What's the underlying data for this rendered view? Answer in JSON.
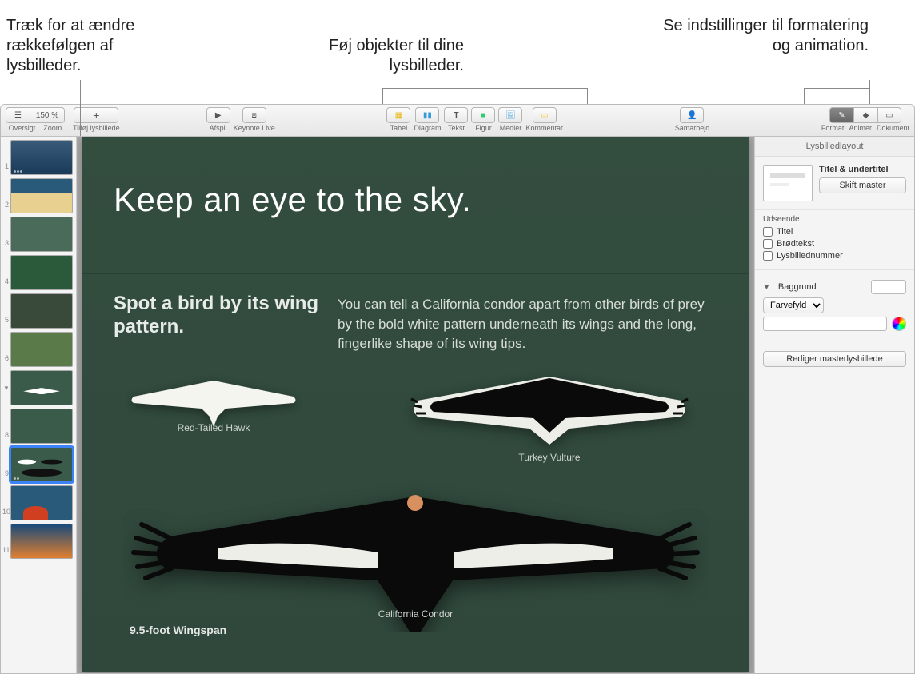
{
  "callouts": {
    "reorder": "Træk for at ændre rækkefølgen af lysbilleder.",
    "objects": "Føj objekter til dine lysbilleder.",
    "format": "Se indstillinger til formatering og animation."
  },
  "toolbar": {
    "oversigt": "Oversigt",
    "zoom_value": "150 %",
    "zoom_label": "Zoom",
    "add_slide": "Tilføj lysbillede",
    "play": "Afspil",
    "keynote_live": "Keynote Live",
    "tabel": "Tabel",
    "diagram": "Diagram",
    "tekst": "Tekst",
    "figur": "Figur",
    "medier": "Medier",
    "kommentar": "Kommentar",
    "samarbejd": "Samarbejd",
    "format": "Format",
    "animer": "Animer",
    "dokument": "Dokument"
  },
  "navigator": {
    "count": 11,
    "selected": 9
  },
  "slide": {
    "title": "Keep an eye to the sky.",
    "subtitle": "Spot a bird by its wing pattern.",
    "body": "You can tell a California condor apart from other birds of prey by the bold white pattern underneath its wings and the long, fingerlike shape of its wing tips.",
    "bird1": "Red-Tailed Hawk",
    "bird2": "Turkey Vulture",
    "bird3": "California Condor",
    "wingspan": "9.5-foot Wingspan"
  },
  "inspector": {
    "header": "Lysbilledlayout",
    "layout_name": "Titel & undertitel",
    "change_master": "Skift master",
    "appearance": "Udseende",
    "title_check": "Titel",
    "body_check": "Brødtekst",
    "slidenum_check": "Lysbillednummer",
    "background": "Baggrund",
    "fill_type": "Farvefyld",
    "edit_master": "Rediger masterlysbillede"
  }
}
